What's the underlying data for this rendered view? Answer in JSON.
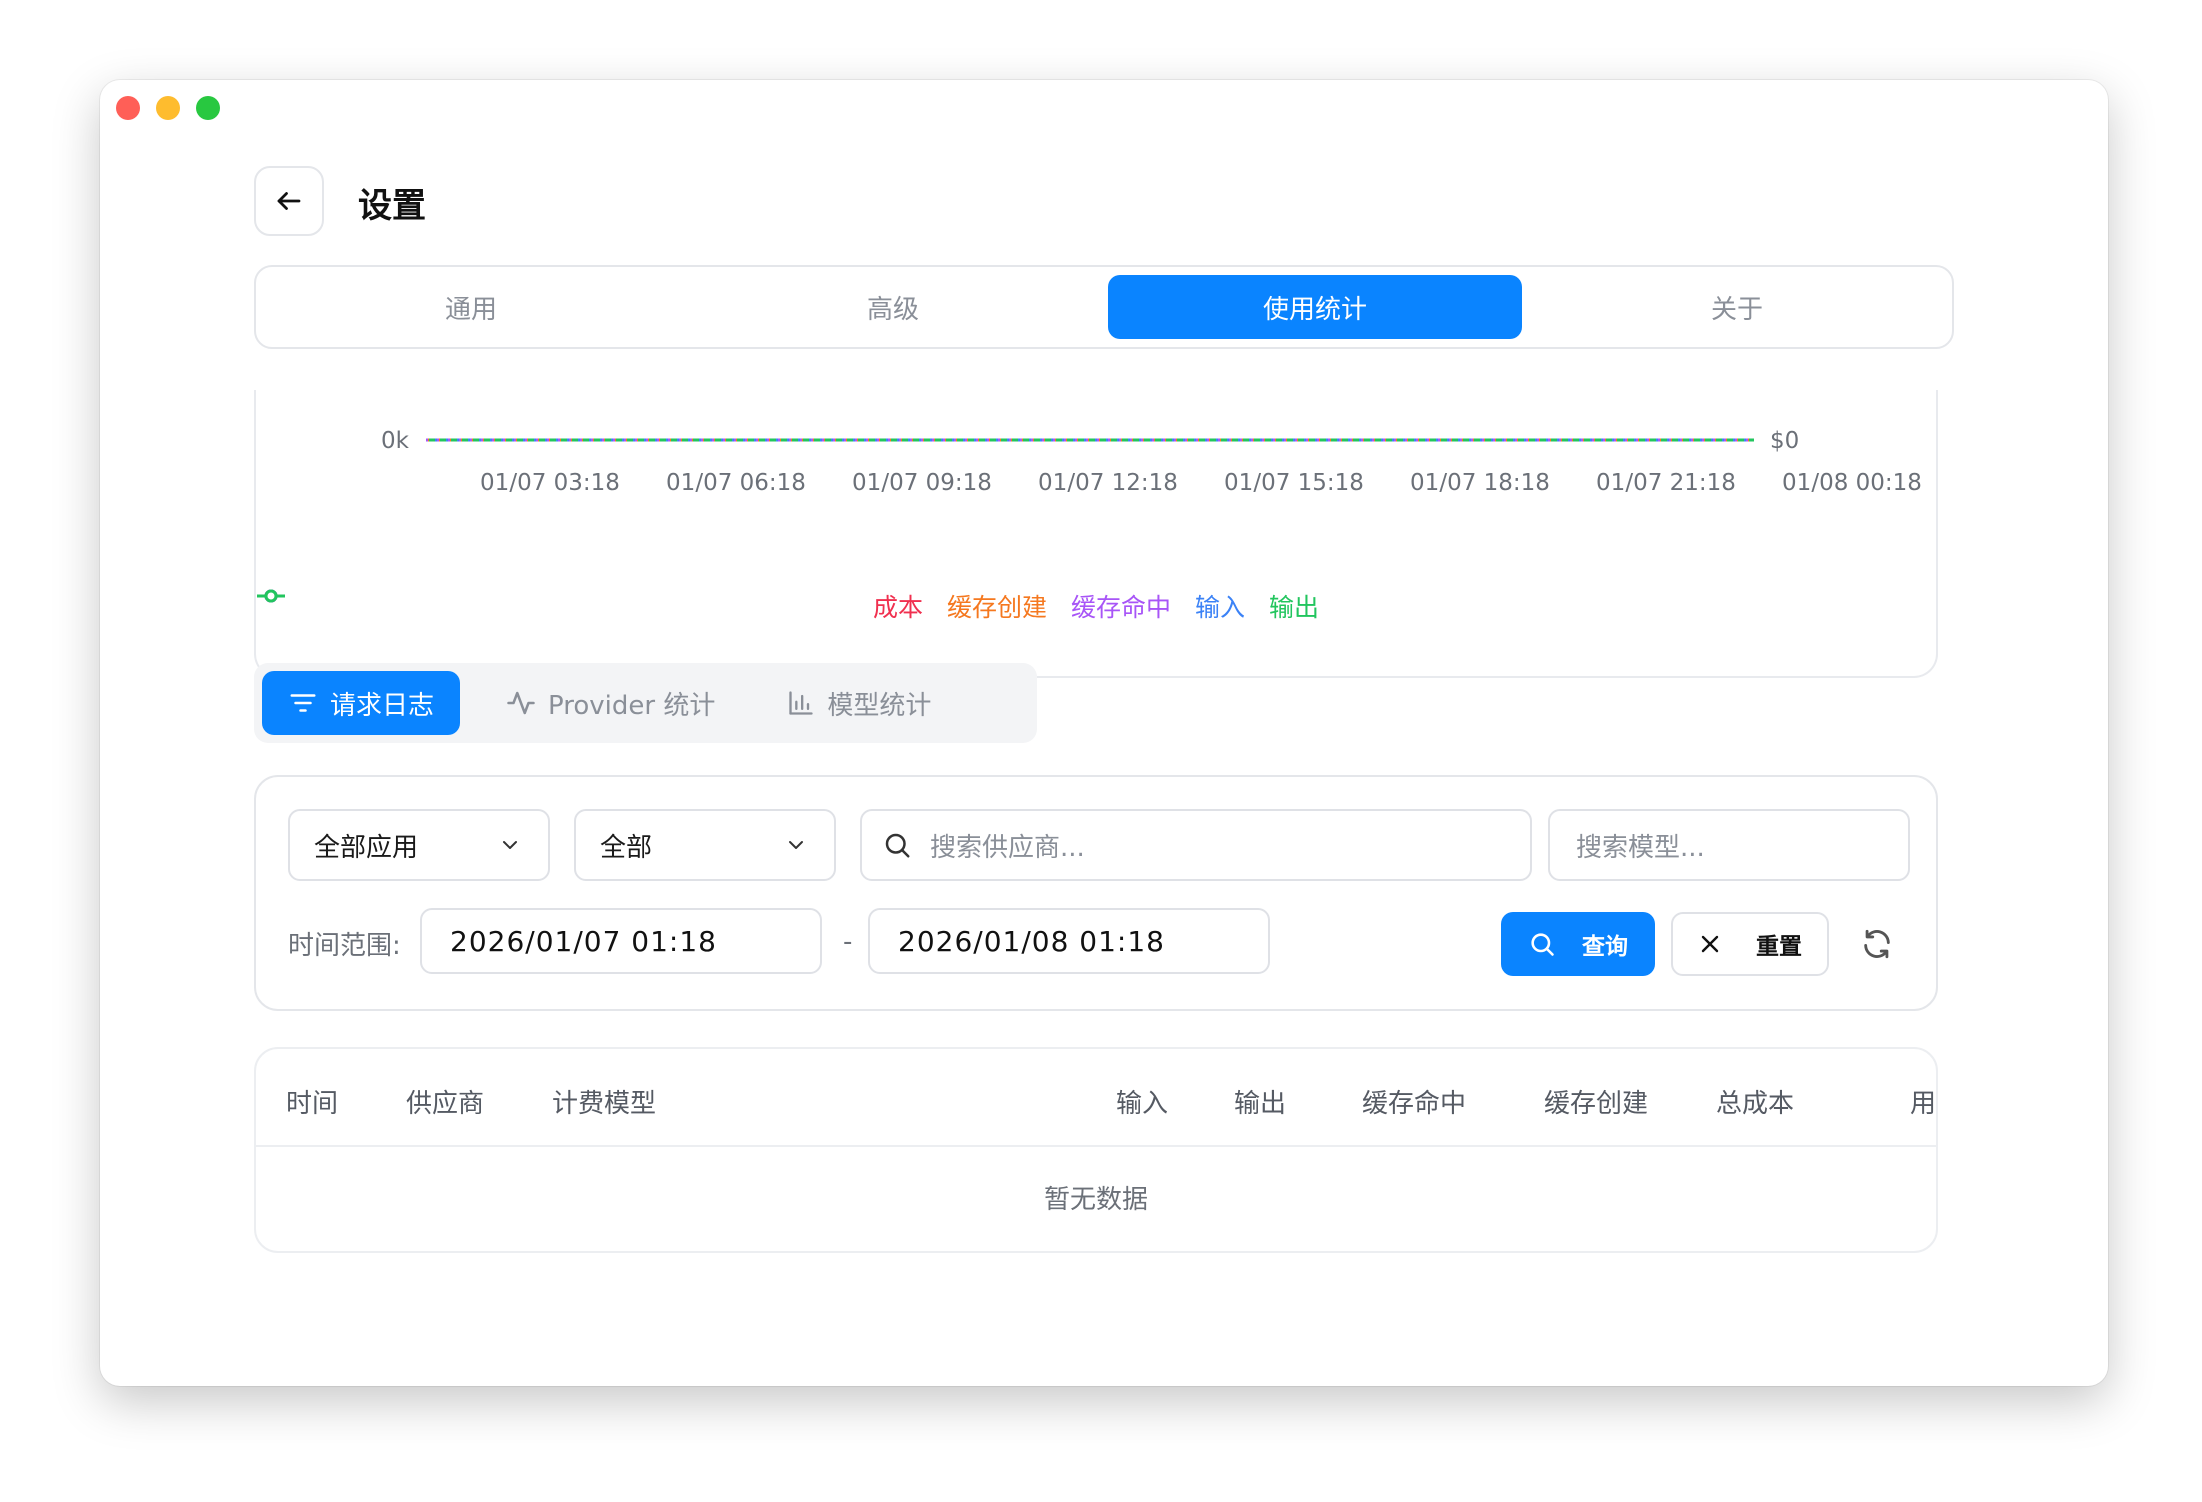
{
  "window": {
    "title": "设置"
  },
  "tabs": [
    {
      "label": "通用",
      "active": false
    },
    {
      "label": "高级",
      "active": false
    },
    {
      "label": "使用统计",
      "active": true
    },
    {
      "label": "关于",
      "active": false
    }
  ],
  "chart_data": {
    "type": "line",
    "y_left_tick": "0k",
    "y_right_tick": "$0",
    "x": [
      "01/07 03:18",
      "01/07 06:18",
      "01/07 09:18",
      "01/07 12:18",
      "01/07 15:18",
      "01/07 18:18",
      "01/07 21:18",
      "01/08 00:18"
    ],
    "series": [
      {
        "name": "成本",
        "color": "#f0304f",
        "values": [
          0,
          0,
          0,
          0,
          0,
          0,
          0,
          0
        ]
      },
      {
        "name": "缓存创建",
        "color": "#f5781f",
        "values": [
          0,
          0,
          0,
          0,
          0,
          0,
          0,
          0
        ]
      },
      {
        "name": "缓存命中",
        "color": "#a855f7",
        "values": [
          0,
          0,
          0,
          0,
          0,
          0,
          0,
          0
        ]
      },
      {
        "name": "输入",
        "color": "#3b82f6",
        "values": [
          0,
          0,
          0,
          0,
          0,
          0,
          0,
          0
        ]
      },
      {
        "name": "输出",
        "color": "#22c55e",
        "values": [
          0,
          0,
          0,
          0,
          0,
          0,
          0,
          0
        ]
      }
    ],
    "ylim": [
      0,
      0
    ],
    "legend": "bottom",
    "grid": false
  },
  "subtabs": [
    {
      "label": "请求日志",
      "icon": "filter-icon",
      "active": true
    },
    {
      "label": "Provider 统计",
      "icon": "activity-icon",
      "active": false
    },
    {
      "label": "模型统计",
      "icon": "bar-chart-icon",
      "active": false
    }
  ],
  "filters": {
    "app_select": "全部应用",
    "status_select": "全部",
    "provider_search_placeholder": "搜索供应商...",
    "model_search_placeholder": "搜索模型...",
    "time_range_label": "时间范围:",
    "start_time": "2026/01/07 01:18",
    "separator": "-",
    "end_time": "2026/01/08 01:18",
    "query_label": "查询",
    "reset_label": "重置"
  },
  "table": {
    "columns": [
      "时间",
      "供应商",
      "计费模型",
      "输入",
      "输出",
      "缓存命中",
      "缓存创建",
      "总成本",
      "用时"
    ],
    "rows": [],
    "empty_text": "暂无数据"
  },
  "colors": {
    "accent": "#0a84ff"
  }
}
